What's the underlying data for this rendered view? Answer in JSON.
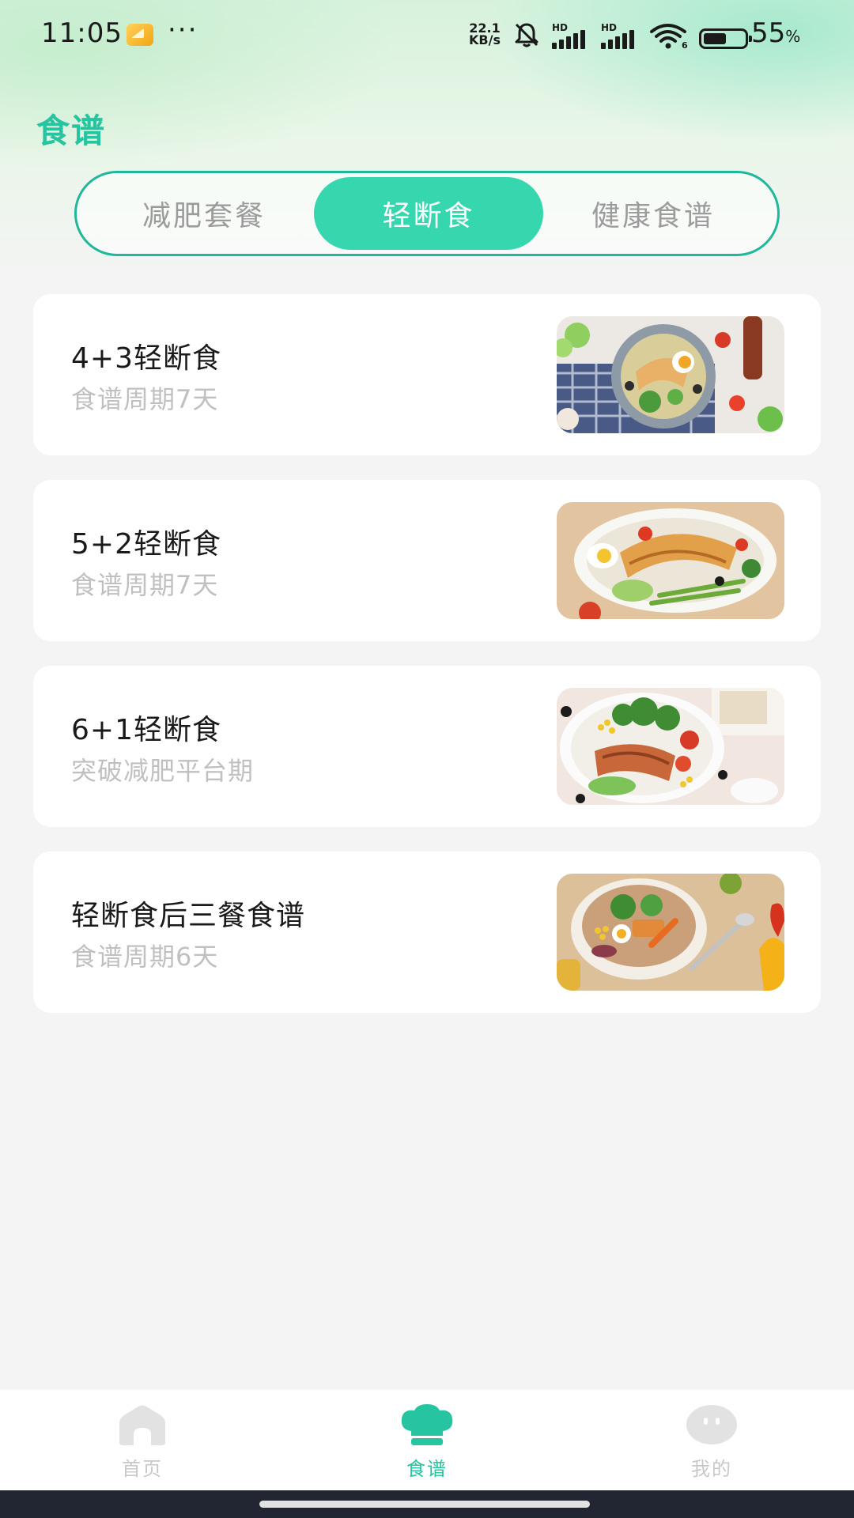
{
  "status_bar": {
    "time": "11:05",
    "more": "···",
    "net_speed_value": "22.1",
    "net_speed_unit": "KB/s",
    "hd_label": "HD",
    "battery_number": "55",
    "battery_percent_sign": "%",
    "battery_level": 0.55
  },
  "page": {
    "title": "食谱"
  },
  "tabs": [
    {
      "label": "减肥套餐",
      "active": false
    },
    {
      "label": "轻断食",
      "active": true
    },
    {
      "label": "健康食谱",
      "active": false
    }
  ],
  "recipes": [
    {
      "title": "4+3轻断食",
      "subtitle": "食谱周期7天",
      "image": "salad-bowl-eggs"
    },
    {
      "title": "5+2轻断食",
      "subtitle": "食谱周期7天",
      "image": "chicken-asparagus-plate"
    },
    {
      "title": "6+1轻断食",
      "subtitle": "突破减肥平台期",
      "image": "grilled-chicken-broccoli"
    },
    {
      "title": "轻断食后三餐食谱",
      "subtitle": "食谱周期6天",
      "image": "veggie-bowl-spoon"
    }
  ],
  "bottom_nav": [
    {
      "label": "首页",
      "icon": "home-icon",
      "active": false
    },
    {
      "label": "食谱",
      "icon": "chef-hat-icon",
      "active": true
    },
    {
      "label": "我的",
      "icon": "profile-face-icon",
      "active": false
    }
  ],
  "colors": {
    "accent": "#26c4a0",
    "tab_active": "#36d6ae",
    "tab_border": "#1fb89a",
    "inactive_text": "#c8c8c8"
  }
}
